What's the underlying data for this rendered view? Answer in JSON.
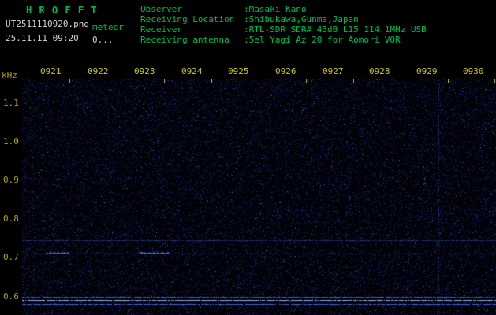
{
  "app": {
    "title": "H R O F F T"
  },
  "header": {
    "filename": "UT2511110920.png",
    "mode": "meteor",
    "datetime": "25.11.11 09:20",
    "counter": "0...",
    "fields": [
      {
        "label": "Observer",
        "value": ":Masaki Kano"
      },
      {
        "label": "Receiving Location",
        "value": ":Shibukawa,Gunma,Japan"
      },
      {
        "label": "Receiver",
        "value": ":RTL-SDR SDR# 43dB L15 114.1MHz USB"
      },
      {
        "label": "Receiving antenna",
        "value": ":5el Yagi Az 20 for Aomori VOR"
      }
    ]
  },
  "spectrogram": {
    "y_unit": "kHz",
    "y_ticks": [
      "1.1",
      "1.0",
      "0.9",
      "0.8",
      "0.7",
      "0.6"
    ],
    "x_ticks": [
      "0921",
      "0922",
      "0923",
      "0924",
      "0925",
      "0926",
      "0927",
      "0928",
      "0929",
      "0930"
    ],
    "freq_range_khz": [
      0.555,
      1.163
    ],
    "signals": {
      "horizontal_lines": [
        {
          "khz": 0.748,
          "intensity": "faint"
        },
        {
          "khz": 0.713,
          "intensity": "faint"
        },
        {
          "khz": 0.602,
          "intensity": "medium"
        },
        {
          "khz": 0.593,
          "intensity": "bright"
        },
        {
          "khz": 0.583,
          "intensity": "medium"
        }
      ],
      "vertical_lines": [
        {
          "t_frac": 0.878,
          "intensity": "faint"
        }
      ],
      "echo_segments": [
        {
          "khz": 0.715,
          "t_frac": 0.05,
          "w_frac": 0.05,
          "intensity": "medium"
        },
        {
          "khz": 0.715,
          "t_frac": 0.25,
          "w_frac": 0.06,
          "intensity": "medium"
        }
      ]
    }
  },
  "colors": {
    "green": "#00b84a",
    "white": "#d4d4d4",
    "yellow": "#a8a018",
    "yellow_bright": "#c9c21f",
    "background": "#000000",
    "noise_blue": "#16296e",
    "signal_blue": "#5a82ff"
  }
}
